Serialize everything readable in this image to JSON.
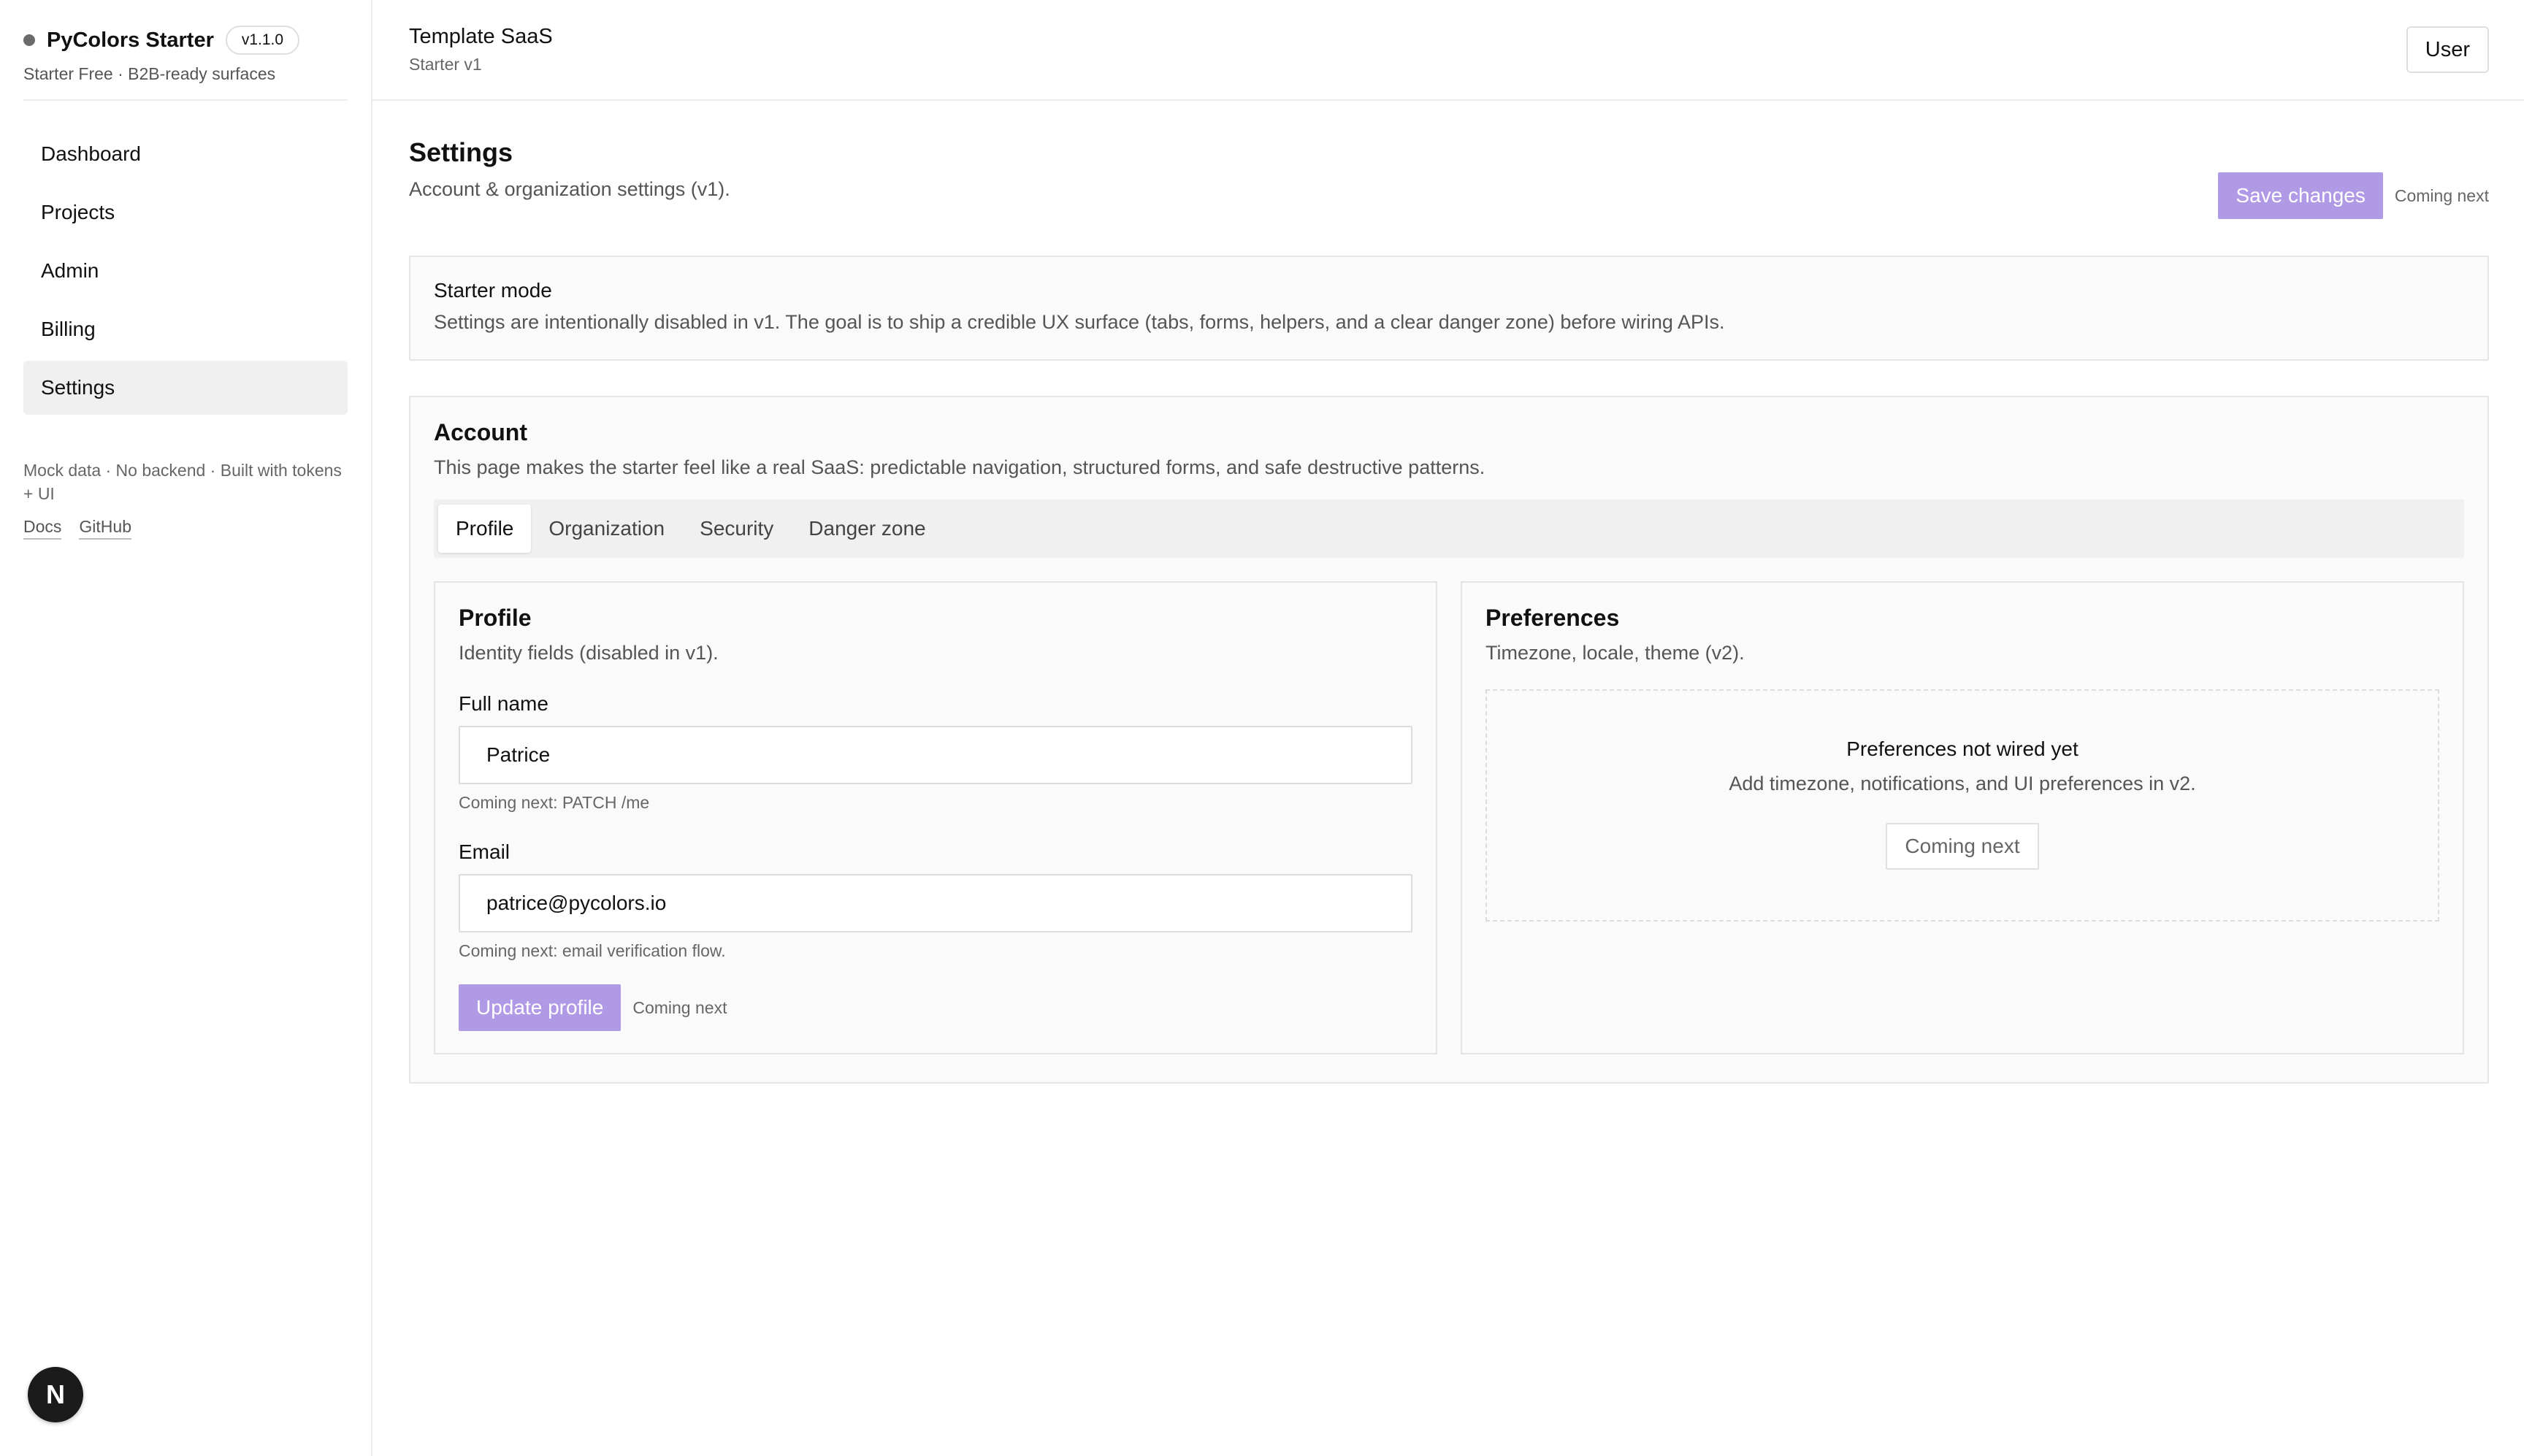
{
  "brand": {
    "name": "PyColors Starter",
    "version": "v1.1.0",
    "subtitle": "Starter Free · B2B-ready surfaces"
  },
  "sidebar": {
    "items": [
      {
        "label": "Dashboard",
        "active": false
      },
      {
        "label": "Projects",
        "active": false
      },
      {
        "label": "Admin",
        "active": false
      },
      {
        "label": "Billing",
        "active": false
      },
      {
        "label": "Settings",
        "active": true
      }
    ],
    "footer_text": "Mock data · No backend · Built with tokens + UI",
    "links": [
      "Docs",
      "GitHub"
    ],
    "floating_badge": "N"
  },
  "topbar": {
    "title": "Template SaaS",
    "subtitle": "Starter v1",
    "user_button": "User"
  },
  "page": {
    "title": "Settings",
    "subtitle": "Account & organization settings (v1).",
    "save_label": "Save changes",
    "save_note": "Coming next"
  },
  "starter_card": {
    "title": "Starter mode",
    "text": "Settings are intentionally disabled in v1. The goal is to ship a credible UX surface (tabs, forms, helpers, and a clear danger zone) before wiring APIs."
  },
  "account": {
    "title": "Account",
    "subtitle": "This page makes the starter feel like a real SaaS: predictable navigation, structured forms, and safe destructive patterns.",
    "tabs": [
      {
        "label": "Profile",
        "active": true
      },
      {
        "label": "Organization",
        "active": false
      },
      {
        "label": "Security",
        "active": false
      },
      {
        "label": "Danger zone",
        "active": false
      }
    ]
  },
  "profile": {
    "title": "Profile",
    "subtitle": "Identity fields (disabled in v1).",
    "full_name_label": "Full name",
    "full_name_value": "Patrice",
    "full_name_help": "Coming next: PATCH /me",
    "email_label": "Email",
    "email_value": "patrice@pycolors.io",
    "email_help": "Coming next: email verification flow.",
    "update_label": "Update profile",
    "update_note": "Coming next"
  },
  "preferences": {
    "title": "Preferences",
    "subtitle": "Timezone, locale, theme (v2).",
    "empty_title": "Preferences not wired yet",
    "empty_text": "Add timezone, notifications, and UI preferences in v2.",
    "button_label": "Coming next"
  },
  "colors": {
    "accent": "#b09ae6",
    "active_nav": "#f0f0f0",
    "card_bg": "#fafafa"
  }
}
